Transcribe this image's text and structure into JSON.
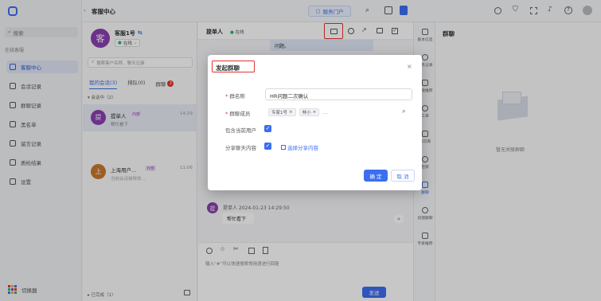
{
  "nav": {
    "search_placeholder": "搜索",
    "section_title": "在线客服",
    "items": [
      {
        "label": "客服中心",
        "icon": "headset-icon"
      },
      {
        "label": "会话记录",
        "icon": "chat-icon"
      },
      {
        "label": "群聊记录",
        "icon": "group-icon"
      },
      {
        "label": "黑名单",
        "icon": "blacklist-icon"
      },
      {
        "label": "留言记录",
        "icon": "message-icon"
      },
      {
        "label": "质检结果",
        "icon": "inspect-icon"
      },
      {
        "label": "设置",
        "icon": "gear-icon"
      }
    ],
    "switcher_label": "切换器"
  },
  "topbar": {
    "title": "客服中心",
    "portal_button": "服务门户"
  },
  "agent": {
    "avatar_char": "客",
    "name": "客服1号",
    "status": "在线",
    "search_placeholder": "搜索客户名称、聊天记录",
    "tabs": [
      {
        "label": "我的会话(3)"
      },
      {
        "label": "排队(0)"
      },
      {
        "label": "群聊",
        "badge": "2"
      }
    ],
    "group_label": "会话中（2）",
    "conversations": [
      {
        "avatar_char": "提",
        "name": "提单人",
        "tag": "内部",
        "time": "14:29",
        "preview": "帮忙看下"
      },
      {
        "avatar_char": "上",
        "name": "上海用户...",
        "tag": "外部",
        "time": "11:06",
        "preview": "当前会话被释放..."
      }
    ],
    "ended_label": "已完成（1）"
  },
  "chat": {
    "title": "提单人",
    "status": "在线",
    "snippet": "问题。",
    "message_sender": "提单人 2024-01-23 14:29:50",
    "message_avatar_char": "提",
    "message_text": "帮忙看下",
    "input_placeholder": "输入“#”可以快速搜索常用语进行回复",
    "send_button": "发送"
  },
  "right_tabs": [
    {
      "label": "基本信息"
    },
    {
      "label": "服务记录"
    },
    {
      "label": "智能推荐"
    },
    {
      "label": "工单"
    },
    {
      "label": "知识库"
    },
    {
      "label": "检索"
    },
    {
      "label": "群聊"
    },
    {
      "label": "创建群聊"
    },
    {
      "label": "专家推荐"
    }
  ],
  "group_panel": {
    "title": "群聊",
    "empty_text": "暂无关联群聊"
  },
  "modal": {
    "title": "发起群聊",
    "name_label": "群名称",
    "name_value": "HR问题二次确认",
    "members_label": "群聊成员",
    "members": [
      "专家1号",
      "林小"
    ],
    "members_more": "...",
    "include_user_label": "包含当前用户",
    "share_label": "分享聊天内容",
    "share_link": "选择分享内容",
    "confirm_button": "确 定",
    "cancel_button": "取 消"
  },
  "colors": {
    "primary": "#3b6ef0",
    "highlight_border": "#e5322d",
    "agent_avatar": "#8b3fb0"
  }
}
